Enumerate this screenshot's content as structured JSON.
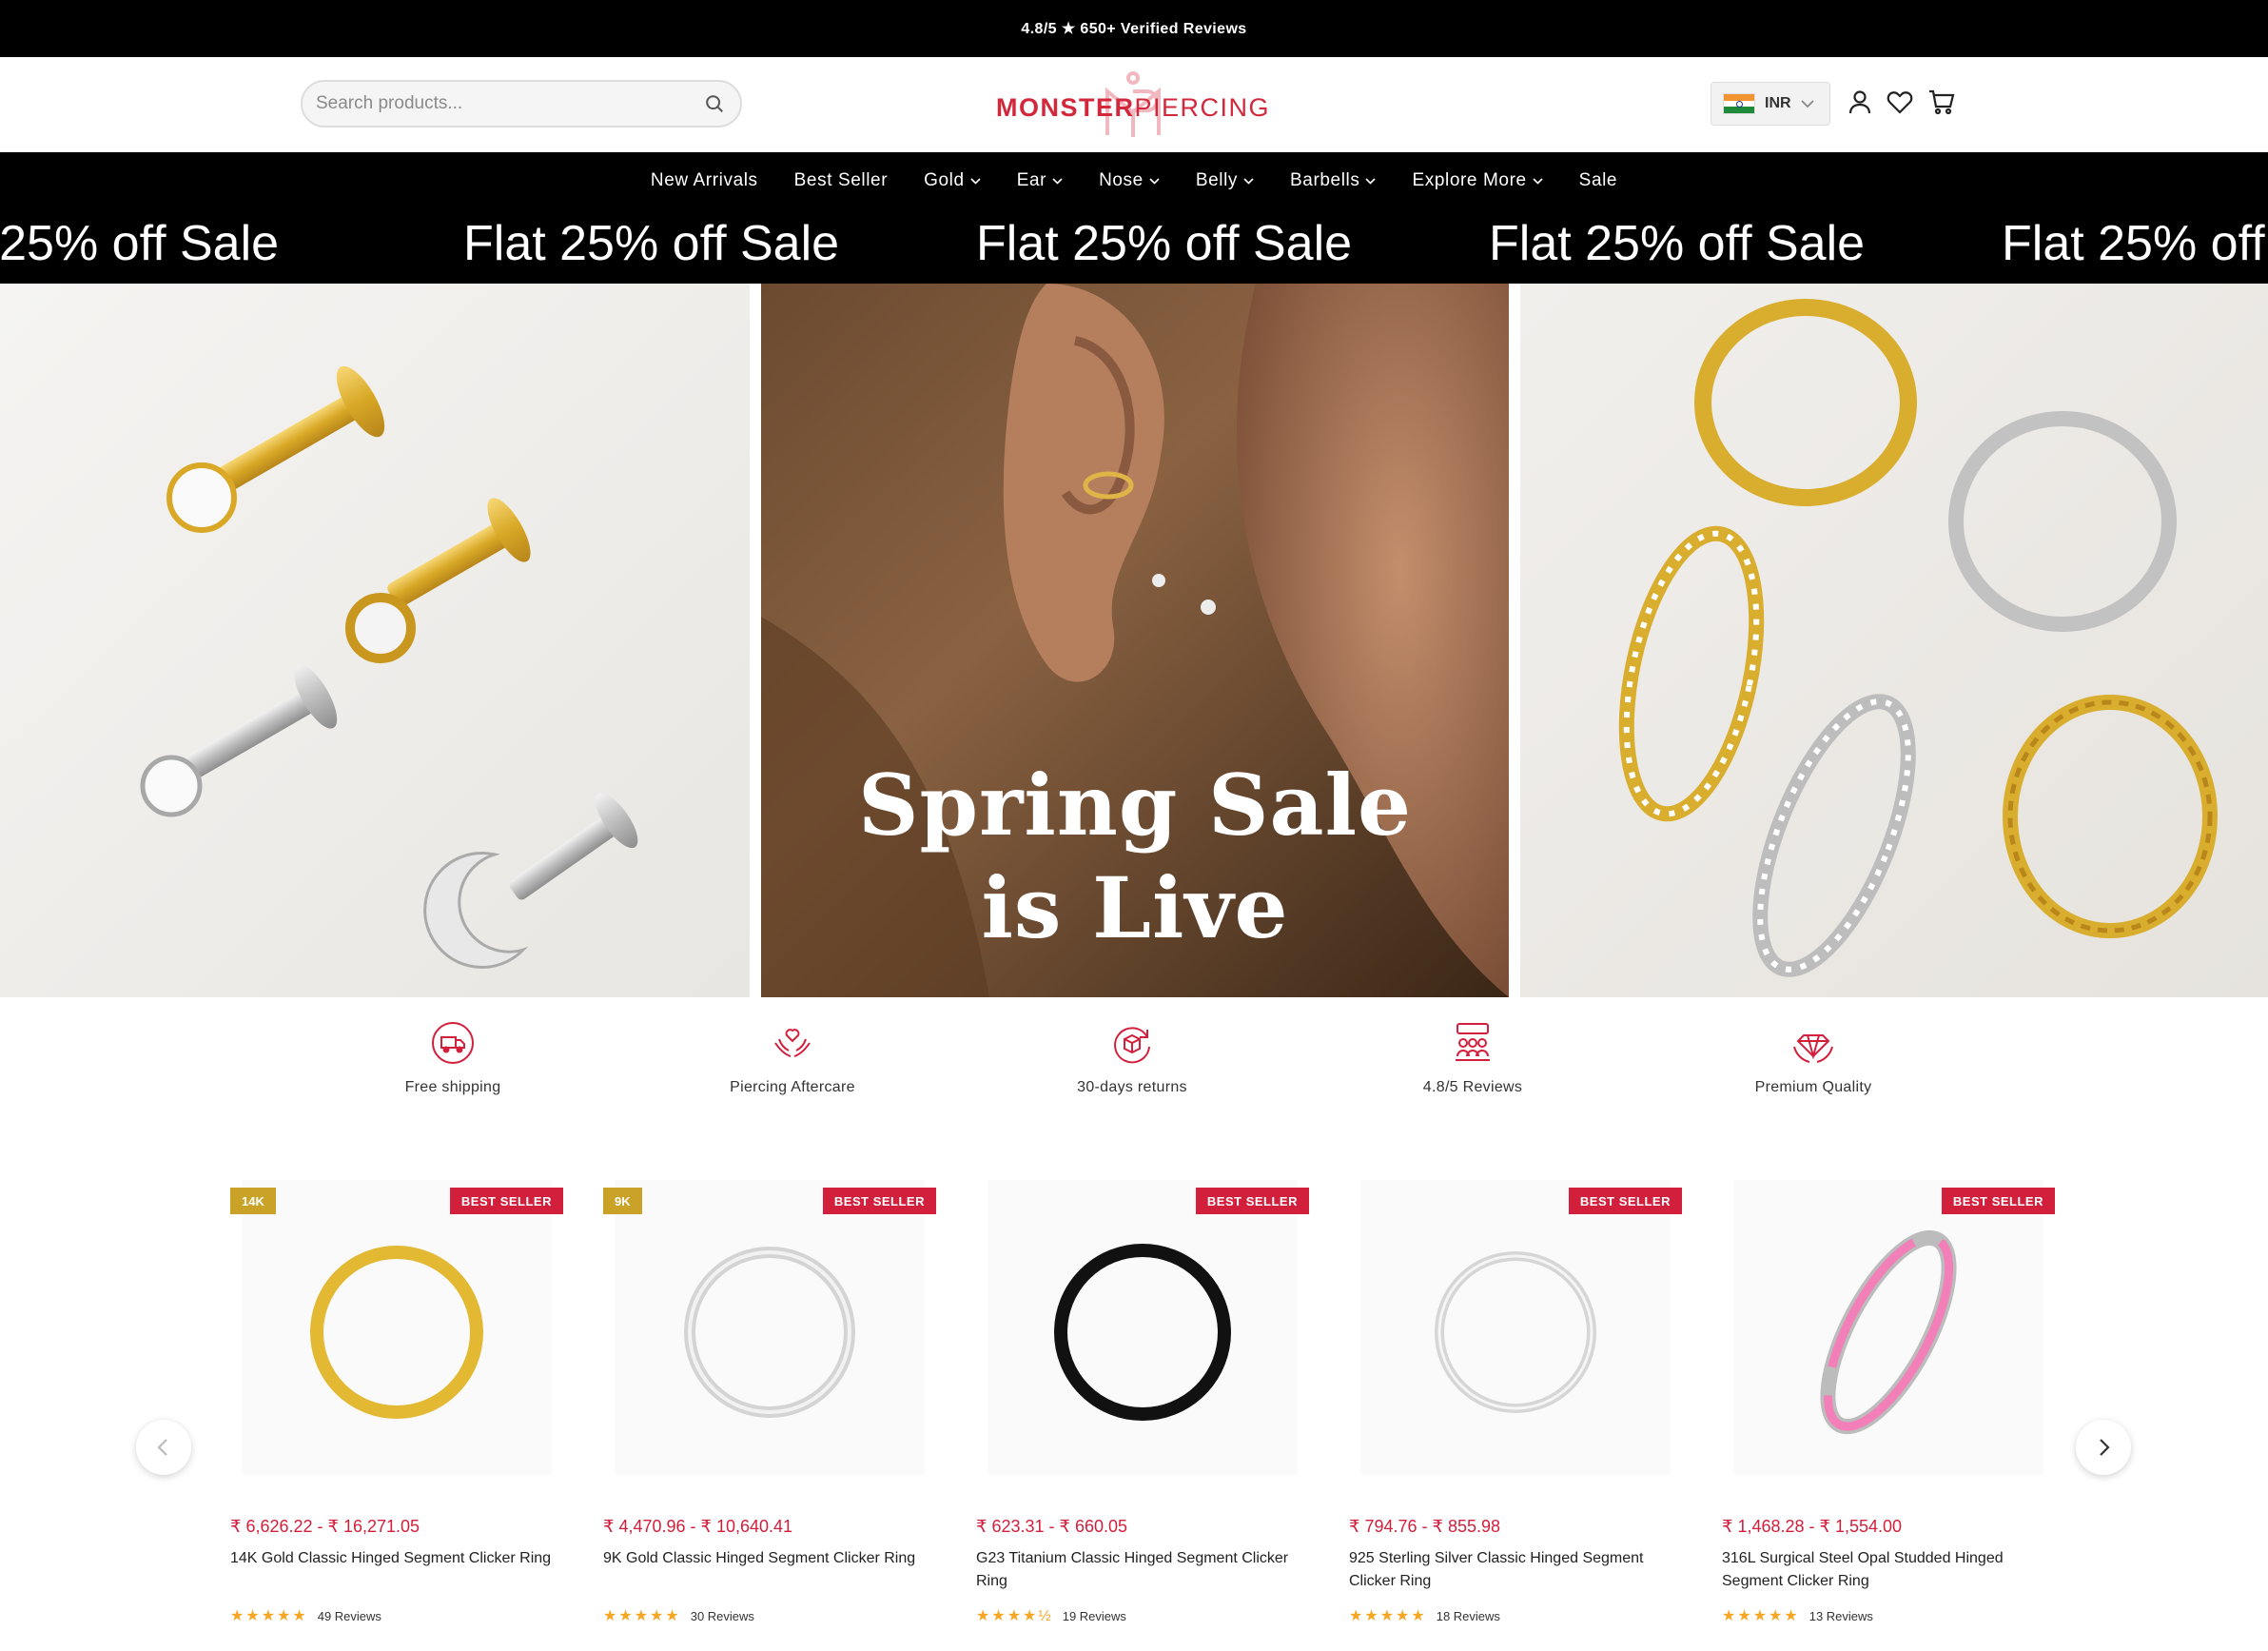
{
  "announcement": "4.8/5 ★ 650+ Verified Reviews",
  "header": {
    "search_placeholder": "Search products...",
    "logo_part1": "MONSTER",
    "logo_part2": "PIERCING",
    "currency": "INR",
    "icons": [
      "user-icon",
      "heart-icon",
      "cart-icon"
    ]
  },
  "nav": {
    "items": [
      {
        "label": "New Arrivals",
        "dropdown": false
      },
      {
        "label": "Best Seller",
        "dropdown": false
      },
      {
        "label": "Gold",
        "dropdown": true
      },
      {
        "label": "Ear",
        "dropdown": true
      },
      {
        "label": "Nose",
        "dropdown": true
      },
      {
        "label": "Belly",
        "dropdown": true
      },
      {
        "label": "Barbells",
        "dropdown": true
      },
      {
        "label": "Explore More",
        "dropdown": true
      },
      {
        "label": "Sale",
        "dropdown": false
      }
    ]
  },
  "marquee": {
    "text": "Flat 25% off Sale"
  },
  "hero": {
    "title_line1": "Spring Sale",
    "title_line2": "is Live"
  },
  "features": [
    {
      "label": "Free shipping",
      "icon": "truck-icon"
    },
    {
      "label": "Piercing Aftercare",
      "icon": "hands-heart-icon"
    },
    {
      "label": "30-days returns",
      "icon": "return-box-icon"
    },
    {
      "label": "4.8/5 Reviews",
      "icon": "reviews-icon"
    },
    {
      "label": "Premium Quality",
      "icon": "diamond-icon"
    }
  ],
  "products": [
    {
      "karat": "14K",
      "badge": "BEST SELLER",
      "price": "₹ 6,626.22 - ₹ 16,271.05",
      "name": "14K Gold Classic Hinged Segment Clicker Ring",
      "stars": "★★★★★",
      "reviews": "49 Reviews",
      "ring_color": "#e8c547"
    },
    {
      "karat": "9K",
      "badge": "BEST SELLER",
      "price": "₹ 4,470.96 - ₹ 10,640.41",
      "name": "9K Gold Classic Hinged Segment Clicker Ring",
      "stars": "★★★★★",
      "reviews": "30 Reviews",
      "ring_color": "#d6d6d6"
    },
    {
      "karat": "",
      "badge": "BEST SELLER",
      "price": "₹ 623.31 - ₹ 660.05",
      "name": "G23 Titanium Classic Hinged Segment Clicker Ring",
      "stars": "★★★★½",
      "reviews": "19 Reviews",
      "ring_color": "#111111"
    },
    {
      "karat": "",
      "badge": "BEST SELLER",
      "price": "₹ 794.76 - ₹ 855.98",
      "name": "925 Sterling Silver Classic Hinged Segment Clicker Ring",
      "stars": "★★★★★",
      "reviews": "18 Reviews",
      "ring_color": "#dadada"
    },
    {
      "karat": "",
      "badge": "BEST SELLER",
      "price": "₹ 1,468.28 - ₹ 1,554.00",
      "name": "316L Surgical Steel Opal Studded Hinged Segment Clicker Ring",
      "stars": "★★★★★",
      "reviews": "13 Reviews",
      "ring_color": "#f27fb8"
    }
  ],
  "colors": {
    "brand_red": "#d21f3c",
    "gold_badge": "#c9a227",
    "star": "#f5a623",
    "nav_bg": "#000000"
  }
}
